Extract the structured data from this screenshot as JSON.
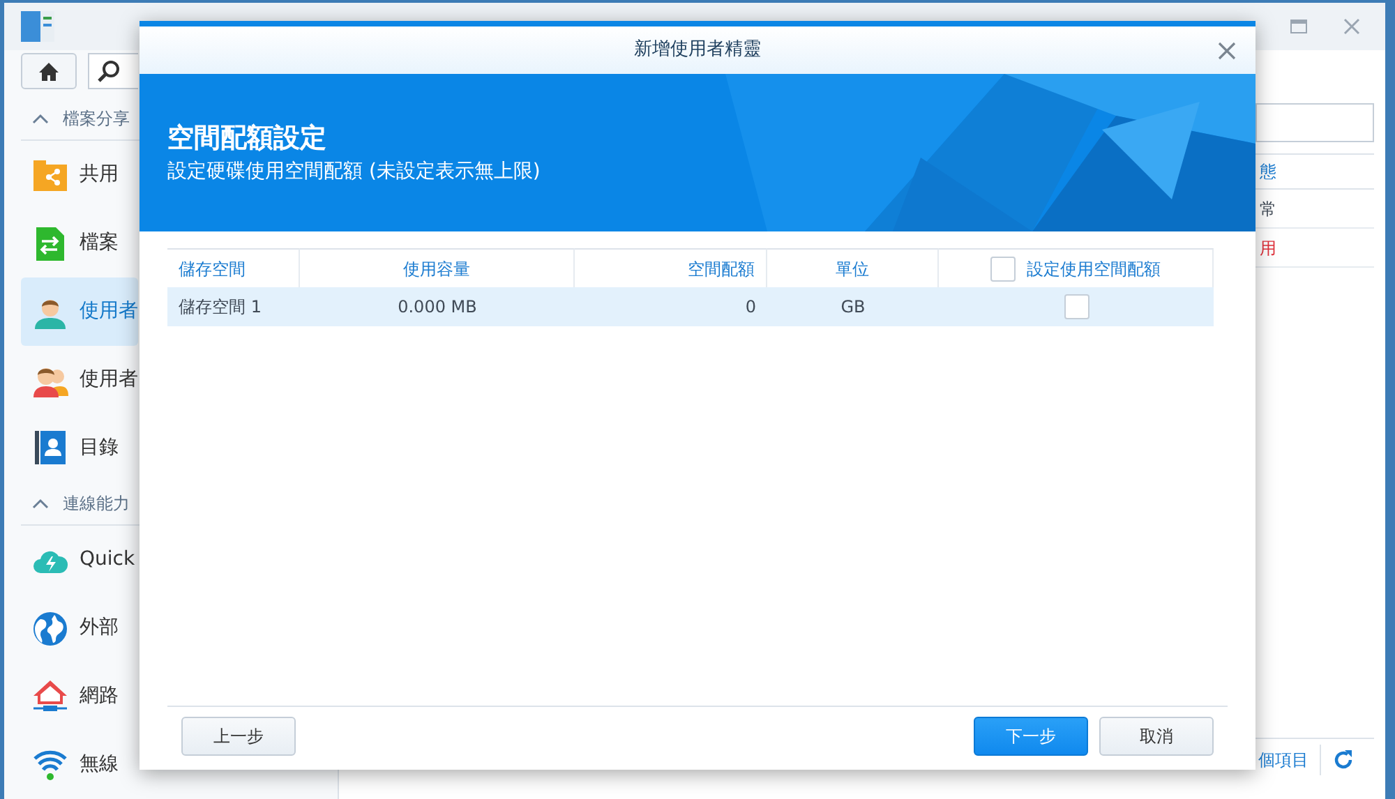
{
  "control_panel": {
    "sidebar": [
      {
        "label": "檔案分享",
        "expanded": true,
        "items": [
          {
            "label": "共用",
            "kind": "folder-share",
            "selected": false
          },
          {
            "label": "檔案",
            "kind": "file-transfer",
            "selected": false
          },
          {
            "label": "使用者",
            "kind": "user",
            "selected": true
          },
          {
            "label": "使用者",
            "kind": "users",
            "selected": false
          },
          {
            "label": "目錄",
            "kind": "directory",
            "selected": false
          }
        ]
      },
      {
        "label": "連線能力",
        "expanded": true,
        "items": [
          {
            "label": "Quick",
            "kind": "cloud",
            "selected": false
          },
          {
            "label": "外部",
            "kind": "globe",
            "selected": false
          },
          {
            "label": "網路",
            "kind": "network",
            "selected": false
          },
          {
            "label": "無線",
            "kind": "wifi",
            "selected": false
          }
        ]
      }
    ],
    "table": {
      "column": "態",
      "rows": [
        {
          "status": "常",
          "kind": "normal"
        },
        {
          "status": "用",
          "kind": "error"
        }
      ]
    },
    "item_count": "個項目"
  },
  "dialog": {
    "title": "新增使用者精靈",
    "heading": "空間配額設定",
    "subtitle": "設定硬碟使用空間配額 (未設定表示無上限)",
    "columns": [
      "儲存空間",
      "使用容量",
      "空間配額",
      "單位",
      "設定使用空間配額"
    ],
    "select_all_checked": false,
    "rows": [
      {
        "storage": "儲存空間 1",
        "used": "0.000 MB",
        "quota": "0",
        "unit": "GB",
        "checked": false,
        "selected": true
      }
    ],
    "buttons": [
      {
        "label": "上一步",
        "kind": "secondary"
      },
      {
        "label": "下一步",
        "kind": "primary"
      },
      {
        "label": "取消",
        "kind": "secondary"
      }
    ]
  }
}
